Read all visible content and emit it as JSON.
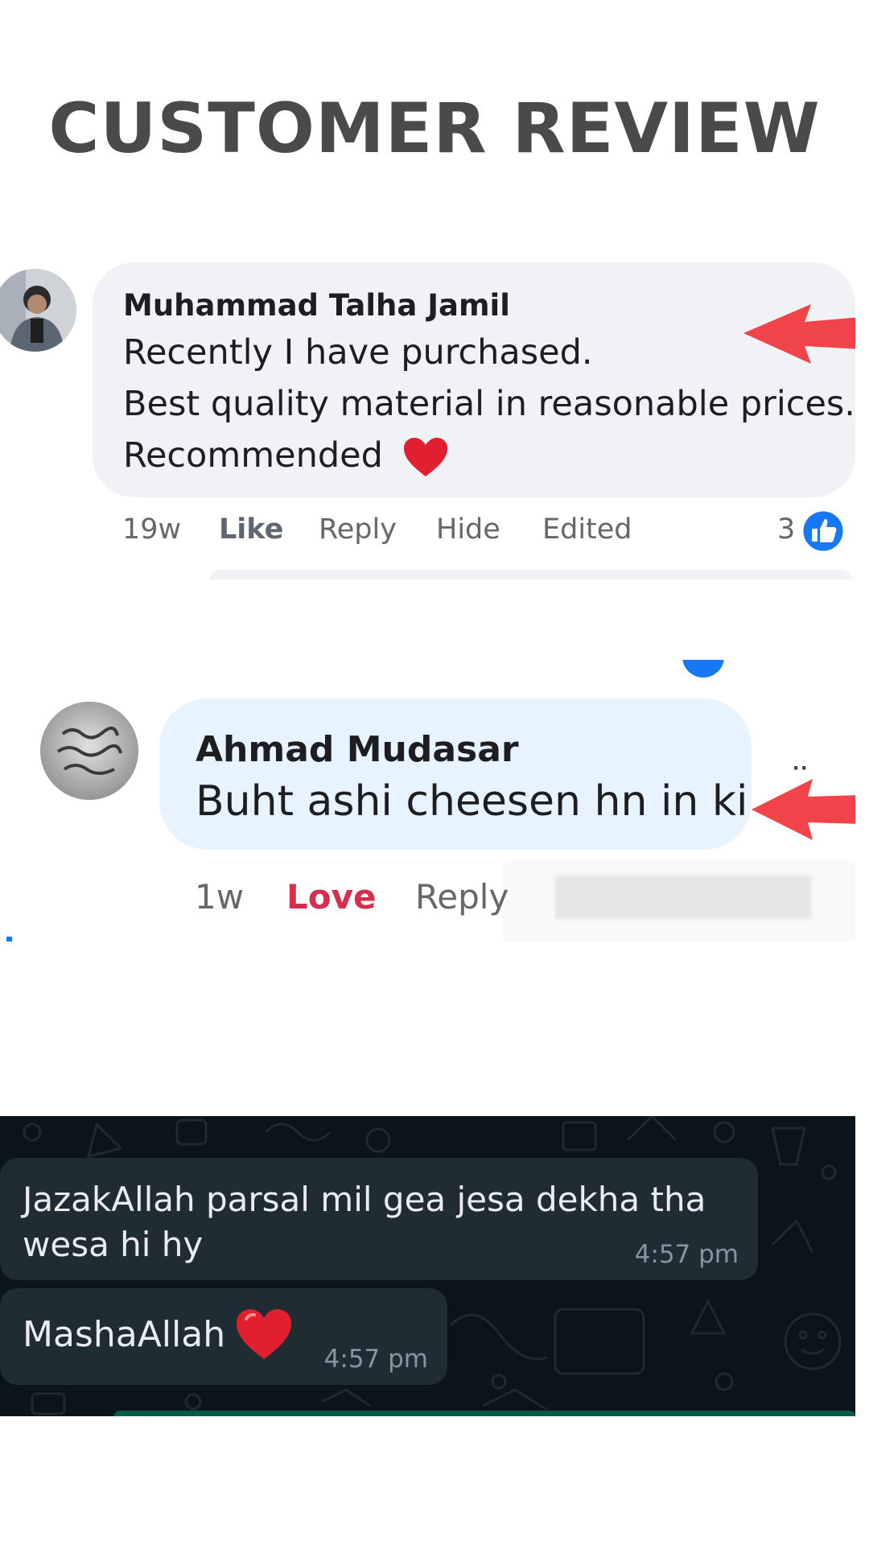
{
  "page": {
    "title": "CUSTOMER REVIEW"
  },
  "review1": {
    "author": "Muhammad Talha Jamil",
    "lines": [
      "Recently I have purchased.",
      "Best quality material in reasonable prices.",
      "Recommended"
    ],
    "time": "19w",
    "actions": {
      "like": "Like",
      "reply": "Reply",
      "hide": "Hide",
      "edited": "Edited"
    },
    "like_count": "3",
    "emoji": "heart-icon"
  },
  "review2": {
    "author": "Ahmad Mudasar",
    "text": "Buht ashi cheesen hn in ki",
    "time": "1w",
    "actions": {
      "love": "Love",
      "reply": "Reply"
    }
  },
  "chat": {
    "messages": [
      {
        "text": "JazakAllah parsal mil gea jesa dekha tha wesa hi hy",
        "time": "4:57 pm"
      },
      {
        "text": "MashaAllah",
        "time": "4:57 pm",
        "emoji": "heart-icon"
      }
    ]
  },
  "colors": {
    "title": "#4a4a4a",
    "fb_bubble": "#f0f2f5",
    "fb_bubble_highlight": "#e7f3ff",
    "fb_blue": "#1877f2",
    "love_red": "#d62e4d",
    "arrow_red": "#f0444a",
    "chat_bg": "#0b141a",
    "chat_bubble": "#202c33"
  }
}
